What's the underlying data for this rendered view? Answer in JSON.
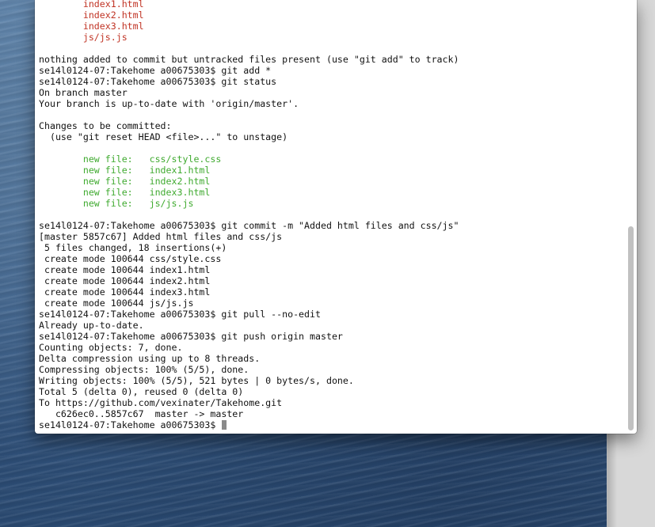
{
  "terminal": {
    "prompt": "se14l0124-07:Takehome a00675303$",
    "lines": [
      {
        "text": "        index1.html",
        "color": "red"
      },
      {
        "text": "        index2.html",
        "color": "red"
      },
      {
        "text": "        index3.html",
        "color": "red"
      },
      {
        "text": "        js/js.js",
        "color": "red"
      },
      {
        "text": "",
        "color": "default"
      },
      {
        "text": "nothing added to commit but untracked files present (use \"git add\" to track)",
        "color": "default"
      },
      {
        "text": "se14l0124-07:Takehome a00675303$ git add *",
        "color": "default"
      },
      {
        "text": "se14l0124-07:Takehome a00675303$ git status",
        "color": "default"
      },
      {
        "text": "On branch master",
        "color": "default"
      },
      {
        "text": "Your branch is up-to-date with 'origin/master'.",
        "color": "default"
      },
      {
        "text": "",
        "color": "default"
      },
      {
        "text": "Changes to be committed:",
        "color": "default"
      },
      {
        "text": "  (use \"git reset HEAD <file>...\" to unstage)",
        "color": "default"
      },
      {
        "text": "",
        "color": "default"
      },
      {
        "text": "        new file:   css/style.css",
        "color": "green"
      },
      {
        "text": "        new file:   index1.html",
        "color": "green"
      },
      {
        "text": "        new file:   index2.html",
        "color": "green"
      },
      {
        "text": "        new file:   index3.html",
        "color": "green"
      },
      {
        "text": "        new file:   js/js.js",
        "color": "green"
      },
      {
        "text": "",
        "color": "default"
      },
      {
        "text": "se14l0124-07:Takehome a00675303$ git commit -m \"Added html files and css/js\"",
        "color": "default"
      },
      {
        "text": "[master 5857c67] Added html files and css/js",
        "color": "default"
      },
      {
        "text": " 5 files changed, 18 insertions(+)",
        "color": "default"
      },
      {
        "text": " create mode 100644 css/style.css",
        "color": "default"
      },
      {
        "text": " create mode 100644 index1.html",
        "color": "default"
      },
      {
        "text": " create mode 100644 index2.html",
        "color": "default"
      },
      {
        "text": " create mode 100644 index3.html",
        "color": "default"
      },
      {
        "text": " create mode 100644 js/js.js",
        "color": "default"
      },
      {
        "text": "se14l0124-07:Takehome a00675303$ git pull --no-edit",
        "color": "default"
      },
      {
        "text": "Already up-to-date.",
        "color": "default"
      },
      {
        "text": "se14l0124-07:Takehome a00675303$ git push origin master",
        "color": "default"
      },
      {
        "text": "Counting objects: 7, done.",
        "color": "default"
      },
      {
        "text": "Delta compression using up to 8 threads.",
        "color": "default"
      },
      {
        "text": "Compressing objects: 100% (5/5), done.",
        "color": "default"
      },
      {
        "text": "Writing objects: 100% (5/5), 521 bytes | 0 bytes/s, done.",
        "color": "default"
      },
      {
        "text": "Total 5 (delta 0), reused 0 (delta 0)",
        "color": "default"
      },
      {
        "text": "To https://github.com/vexinater/Takehome.git",
        "color": "default"
      },
      {
        "text": "   c626ec0..5857c67  master -> master",
        "color": "default"
      }
    ]
  },
  "colors": {
    "red": "#c03324",
    "green": "#3faa2f",
    "text": "#111111",
    "background": "#ffffff"
  }
}
